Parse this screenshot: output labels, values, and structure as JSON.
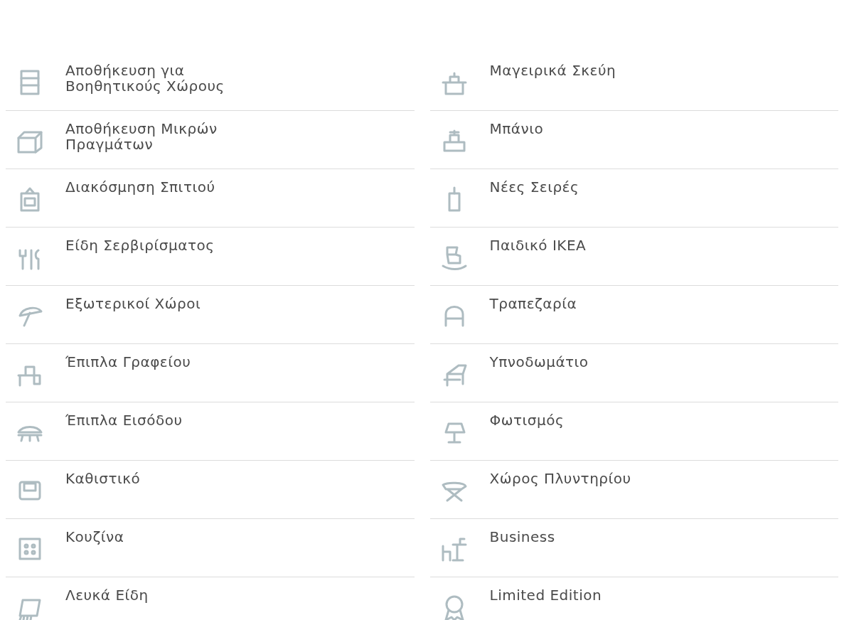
{
  "left_column": [
    {
      "label": "Αποθήκευση για Βοηθητικούς Χώρους"
    },
    {
      "label": "Αποθήκευση Μικρών Πραγμάτων"
    },
    {
      "label": "Διακόσμηση Σπιτιού"
    },
    {
      "label": "Είδη Σερβιρίσματος"
    },
    {
      "label": "Εξωτερικοί Χώροι"
    },
    {
      "label": "Έπιπλα Γραφείου"
    },
    {
      "label": "Έπιπλα Εισόδου"
    },
    {
      "label": "Καθιστικό"
    },
    {
      "label": "Κουζίνα"
    },
    {
      "label": "Λευκά Είδη"
    }
  ],
  "right_column": [
    {
      "label": "Μαγειρικά Σκεύη"
    },
    {
      "label": "Μπάνιο"
    },
    {
      "label": "Νέες Σειρές"
    },
    {
      "label": "Παιδικό IKEA"
    },
    {
      "label": "Τραπεζαρία"
    },
    {
      "label": "Υπνοδωμάτιο"
    },
    {
      "label": "Φωτισμός"
    },
    {
      "label": "Χώρος Πλυντηρίου"
    },
    {
      "label": "Business"
    },
    {
      "label": "Limited Edition"
    }
  ]
}
